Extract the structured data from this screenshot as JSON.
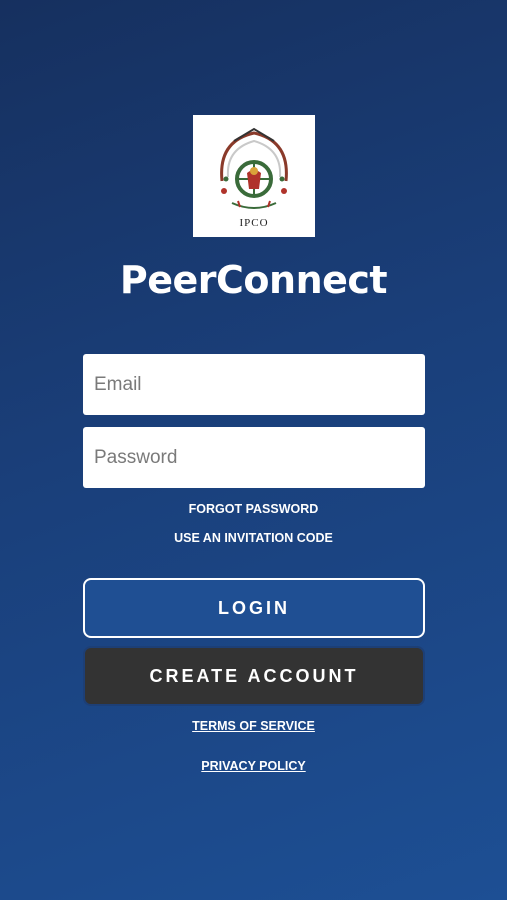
{
  "logo": {
    "label": "IPCO",
    "accent_red": "#b0332b",
    "accent_green": "#3a6b3a"
  },
  "app_title": "PeerConnect",
  "email": {
    "placeholder": "Email",
    "value": ""
  },
  "password": {
    "placeholder": "Password",
    "value": ""
  },
  "links": {
    "forgot_password": "FORGOT PASSWORD",
    "invitation_code": "USE AN INVITATION CODE",
    "terms": "TERMS OF SERVICE",
    "privacy": "PRIVACY POLICY"
  },
  "buttons": {
    "login": "LOGIN",
    "create_account": "CREATE ACCOUNT"
  },
  "colors": {
    "background_top": "#16305f",
    "background_bottom": "#1d4f94",
    "login_button": "#1f4f93",
    "create_button": "#333333"
  }
}
